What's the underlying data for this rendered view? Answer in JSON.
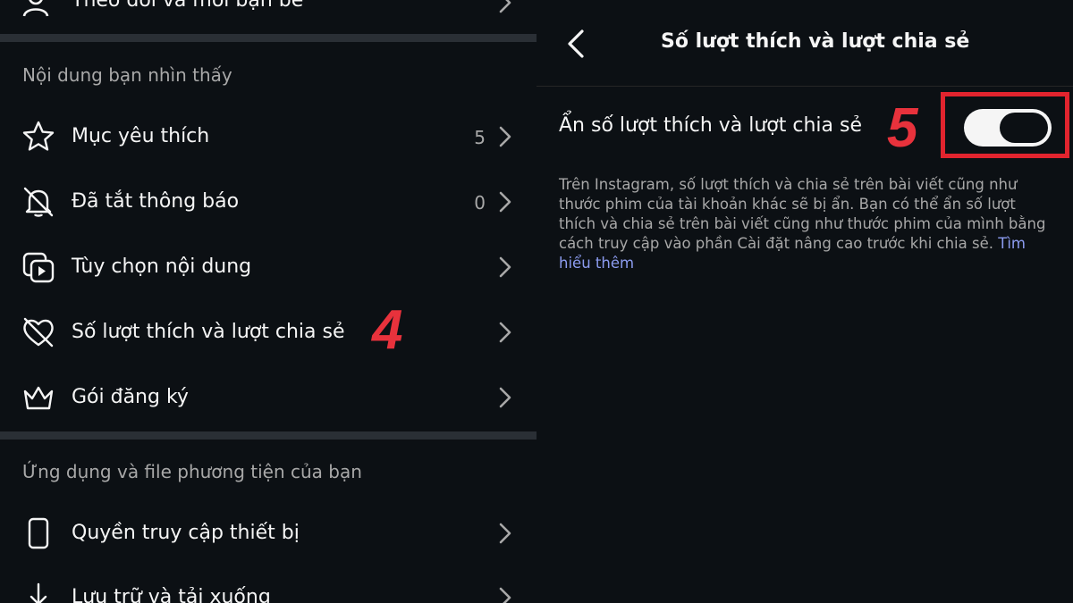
{
  "left": {
    "top_item": {
      "label": "Theo dõi và mời bạn bè"
    },
    "section1_title": "Nội dung bạn nhìn thấy",
    "items": [
      {
        "label": "Mục yêu thích",
        "count": "5"
      },
      {
        "label": "Đã tắt thông báo",
        "count": "0"
      },
      {
        "label": "Tùy chọn nội dung",
        "count": ""
      },
      {
        "label": "Số lượt thích và lượt chia sẻ",
        "count": ""
      },
      {
        "label": "Gói đăng ký",
        "count": ""
      }
    ],
    "section2_title": "Ứng dụng và file phương tiện của bạn",
    "items2": [
      {
        "label": "Quyền truy cập thiết bị"
      },
      {
        "label": "Lưu trữ và tải xuống"
      }
    ],
    "annotation": "4"
  },
  "right": {
    "header_title": "Số lượt thích và lượt chia sẻ",
    "setting_label": "Ẩn số lượt thích và lượt chia sẻ",
    "toggle_on": true,
    "annotation": "5",
    "description": "Trên Instagram, số lượt thích và chia sẻ trên bài viết cũng như thước phim của tài khoản khác sẽ bị ẩn. Bạn có thể ẩn số lượt thích và chia sẻ trên bài viết cũng như thước phim của mình bằng cách truy cập vào phần Cài đặt nâng cao trước khi chia sẻ.",
    "learn_more": "Tìm hiểu thêm"
  },
  "colors": {
    "background": "#0c1014",
    "annotation": "#e8323c",
    "link": "#8c9cf0"
  }
}
